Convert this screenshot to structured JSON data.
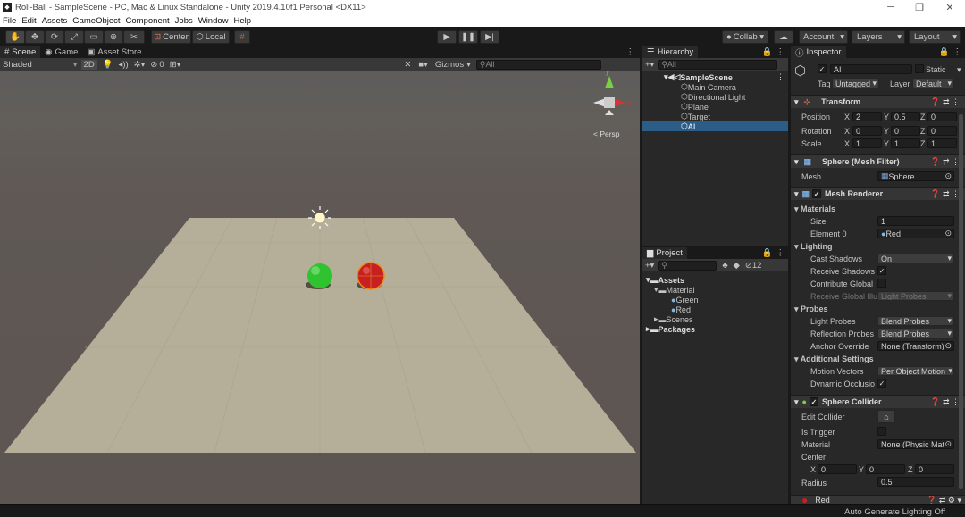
{
  "window": {
    "title": "Roll-Ball - SampleScene - PC, Mac & Linux Standalone - Unity 2019.4.10f1 Personal <DX11>"
  },
  "menu": [
    "File",
    "Edit",
    "Assets",
    "GameObject",
    "Component",
    "Jobs",
    "Window",
    "Help"
  ],
  "toolbar": {
    "pivot": "Center",
    "space": "Local",
    "collab": "Collab ▾",
    "account": "Account",
    "layers": "Layers",
    "layout": "Layout"
  },
  "scene": {
    "tabs": [
      "Scene",
      "Game",
      "Asset Store"
    ],
    "shading": "Shaded",
    "mode2d": "2D",
    "hidden_count": "0",
    "gizmos": "Gizmos",
    "search": "All",
    "persp": "< Persp"
  },
  "hierarchy": {
    "tab": "Hierarchy",
    "search": "All",
    "scene": "SampleScene",
    "items": [
      "Main Camera",
      "Directional Light",
      "Plane",
      "Target",
      "AI"
    ]
  },
  "project": {
    "tab": "Project",
    "count": "12",
    "tree": [
      "Assets",
      "Material",
      "Green",
      "Red",
      "Scenes",
      "Packages"
    ]
  },
  "inspector": {
    "tab": "Inspector",
    "name": "AI",
    "static": "Static",
    "tag_label": "Tag",
    "tag": "Untagged",
    "layer_label": "Layer",
    "layer": "Default",
    "transform": {
      "title": "Transform",
      "labels": [
        "Position",
        "Rotation",
        "Scale"
      ],
      "position": {
        "x": "2",
        "y": "0.5",
        "z": "0"
      },
      "rotation": {
        "x": "0",
        "y": "0",
        "z": "0"
      },
      "scale": {
        "x": "1",
        "y": "1",
        "z": "1"
      }
    },
    "mesh_filter": {
      "title": "Sphere (Mesh Filter)",
      "mesh_label": "Mesh",
      "mesh": "Sphere"
    },
    "mesh_renderer": {
      "title": "Mesh Renderer",
      "materials": "Materials",
      "size_label": "Size",
      "size": "1",
      "element_label": "Element 0",
      "element": "Red",
      "lighting": "Lighting",
      "cast_label": "Cast Shadows",
      "cast": "On",
      "receive_label": "Receive Shadows",
      "contribute_label": "Contribute Global",
      "receive_gi_label": "Receive Global Illu",
      "receive_gi": "Light Probes",
      "probes": "Probes",
      "light_probes_label": "Light Probes",
      "light_probes": "Blend Probes",
      "reflection_label": "Reflection Probes",
      "reflection": "Blend Probes",
      "anchor_label": "Anchor Override",
      "anchor": "None (Transform)",
      "additional": "Additional Settings",
      "motion_label": "Motion Vectors",
      "motion": "Per Object Motion",
      "dynamic_label": "Dynamic Occlusio"
    },
    "sphere_collider": {
      "title": "Sphere Collider",
      "edit_label": "Edit Collider",
      "trigger_label": "Is Trigger",
      "material_label": "Material",
      "material": "None (Physic Mat",
      "center_label": "Center",
      "center": {
        "x": "0",
        "y": "0",
        "z": "0"
      },
      "radius_label": "Radius",
      "radius": "0.5"
    },
    "material_preview": "Red"
  },
  "status": {
    "lighting": "Auto Generate Lighting Off"
  },
  "colors": {
    "accent": "#2c5d87",
    "selection": "#2c5d87",
    "green_ball": "#2fc42f",
    "red_ball": "#c72020",
    "plane": "#b5ae98"
  }
}
